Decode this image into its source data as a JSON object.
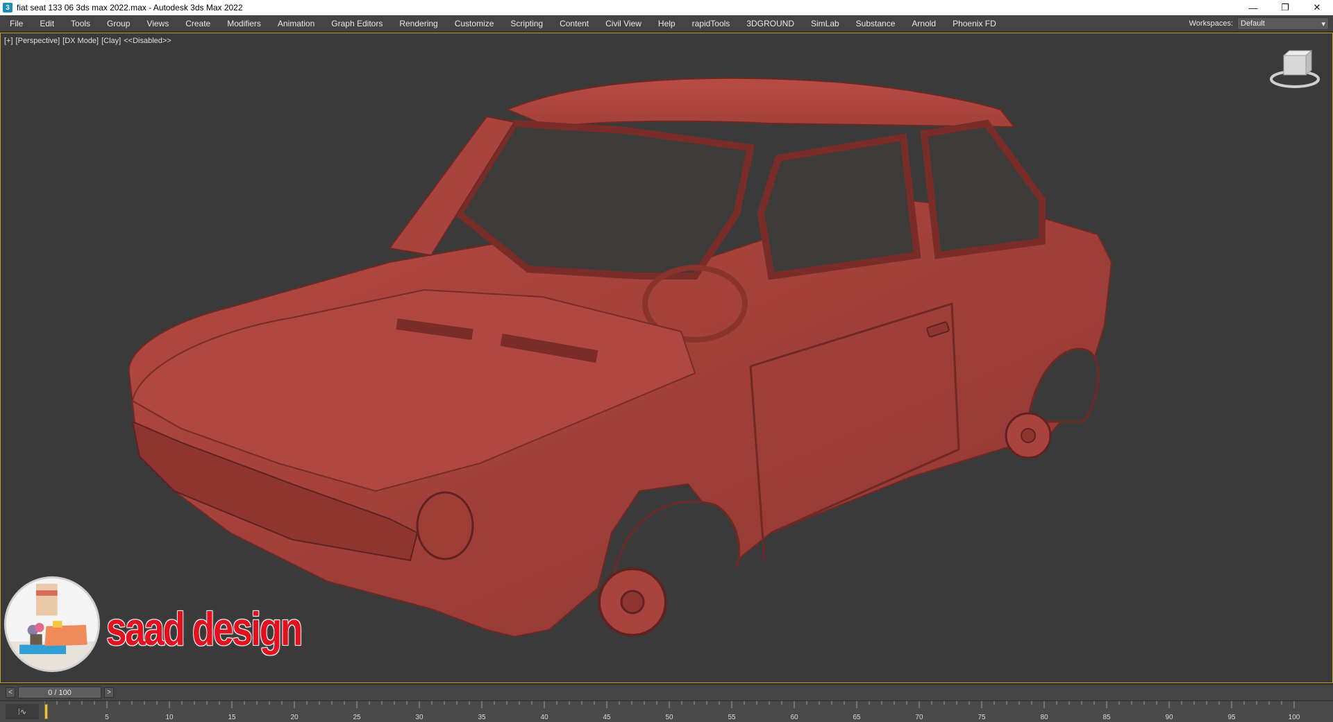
{
  "window": {
    "title": "fiat seat 133 06 3ds max 2022.max - Autodesk 3ds Max 2022",
    "app_icon": "3ds-max-icon",
    "minimize_glyph": "—",
    "restore_glyph": "❐",
    "close_glyph": "✕"
  },
  "menu": {
    "items": [
      "File",
      "Edit",
      "Tools",
      "Group",
      "Views",
      "Create",
      "Modifiers",
      "Animation",
      "Graph Editors",
      "Rendering",
      "Customize",
      "Scripting",
      "Content",
      "Civil View",
      "Help",
      "rapidTools",
      "3DGROUND",
      "SimLab",
      "Substance",
      "Arnold",
      "Phoenix FD"
    ],
    "workspaces_label": "Workspaces:",
    "workspace_value": "Default"
  },
  "viewport": {
    "labels": [
      "[+]",
      "[Perspective]",
      "[DX Mode]",
      "[Clay]",
      "<<Disabled>>"
    ],
    "model_color": "#a8403a",
    "border_color": "#bfa040"
  },
  "watermark": {
    "text": "saad design",
    "text_color": "#e3101f"
  },
  "timeslider": {
    "position_text": "0 / 100",
    "prev_glyph": "<",
    "next_glyph": ">"
  },
  "trackbar": {
    "left_icon": "key-filter-icon",
    "ticks": [
      "5",
      "10",
      "15",
      "20",
      "25",
      "30",
      "35",
      "40",
      "45",
      "50",
      "55",
      "60",
      "65",
      "70",
      "75",
      "80",
      "85",
      "90",
      "95",
      "100"
    ],
    "frame_start": 0,
    "frame_end": 100,
    "current_frame": 0
  }
}
